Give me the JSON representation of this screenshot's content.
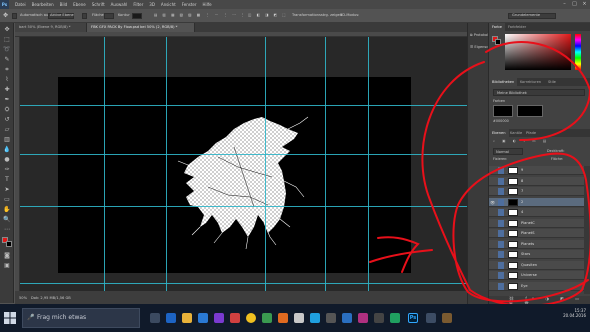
{
  "menubar": {
    "logo": "Ps",
    "items": [
      "Datei",
      "Bearbeiten",
      "Bild",
      "Ebene",
      "Schrift",
      "Auswahl",
      "Filter",
      "3D",
      "Ansicht",
      "Fenster",
      "Hilfe"
    ]
  },
  "options_bar": {
    "auto_select_label": "Automatisch ausw.",
    "auto_select_value": "Aktive Ebene",
    "bounding_label": "Transformationsstrg. zeigen",
    "align_label": "Fläche",
    "opacity_label": "Kontur",
    "mode_label": "3D-Modus:",
    "workspace": "Grundelemente"
  },
  "tabs": [
    {
      "label": "bart 50% (Ebene 9, RGB/8) *"
    },
    {
      "label": "FBK GFX PACK By Flow.psd bei 50% (2, RGB/8) *",
      "active": true
    }
  ],
  "status": {
    "zoom": "50%",
    "doc": "Dok: 2,95 MB/1,56 GB"
  },
  "dock": {
    "items": [
      "Protokoll",
      "Eigenschaften"
    ]
  },
  "color_panel": {
    "tabs": [
      "Farbe",
      "Farbfelder"
    ],
    "fg": "#e01818",
    "bg": "#000000"
  },
  "libraries_panel": {
    "tabs": [
      "Bibliotheken",
      "Korrekturen",
      "Stile"
    ],
    "library_name": "Meine Bibliothek",
    "section": "Farben",
    "swatch_label": "#000000"
  },
  "layers_panel": {
    "tabs": [
      "Ebenen",
      "Kanäle",
      "Pfade"
    ],
    "blend_mode": "Normal",
    "opacity_label": "Deckkraft:",
    "lock_label": "Fixieren:",
    "fill_label": "Fläche:",
    "layers": [
      {
        "name": "9",
        "visible": false,
        "selected": false
      },
      {
        "name": "8",
        "visible": false,
        "selected": false
      },
      {
        "name": "7",
        "visible": false,
        "selected": false
      },
      {
        "name": "2",
        "visible": true,
        "selected": true
      },
      {
        "name": "4",
        "visible": false,
        "selected": false
      },
      {
        "name": "PlanetC",
        "visible": false,
        "selected": false
      },
      {
        "name": "PlanetS",
        "visible": false,
        "selected": false
      },
      {
        "name": "Planets",
        "visible": false,
        "selected": false
      },
      {
        "name": "Stars",
        "visible": false,
        "selected": false
      },
      {
        "name": "Quasiten",
        "visible": false,
        "selected": false
      },
      {
        "name": "Universe",
        "visible": false,
        "selected": false
      },
      {
        "name": "Eye",
        "visible": false,
        "selected": false
      }
    ]
  },
  "taskbar": {
    "search_placeholder": "Frag mich etwas",
    "time": "15:37",
    "date": "20.04.2016"
  },
  "colors": {
    "guide": "#2fb5c8",
    "annotation": "#e8101a",
    "accent": "#4e6e9e"
  }
}
